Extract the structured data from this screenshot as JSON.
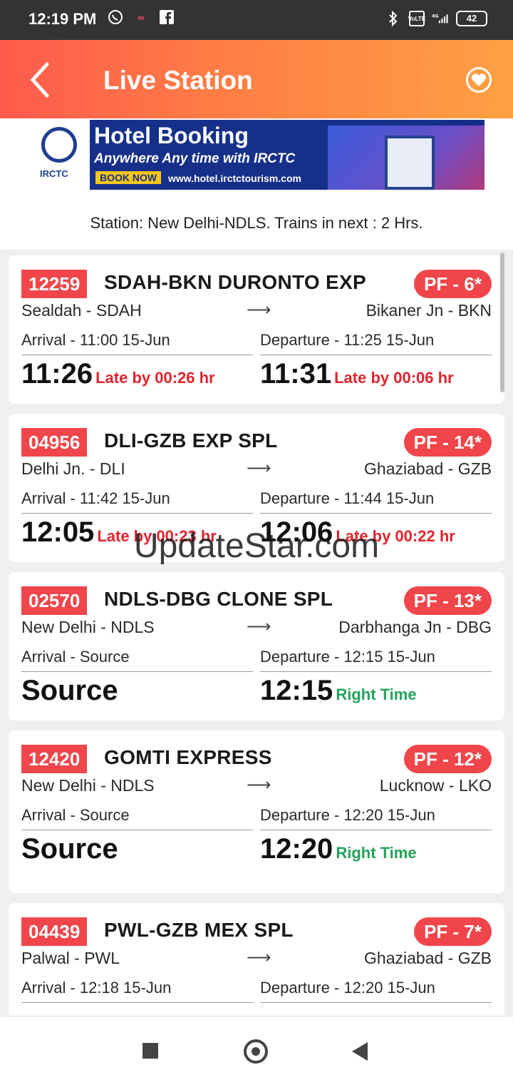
{
  "status_bar": {
    "time": "12:19 PM",
    "battery": "42",
    "network": "4G"
  },
  "app_bar": {
    "title": "Live Station"
  },
  "banner": {
    "logo_text": "IRCTC",
    "title": "Hotel Booking",
    "subtitle": "Anywhere Any time with IRCTC",
    "button": "BOOK NOW",
    "url": "www.hotel.irctctourism.com"
  },
  "station_info": "Station: New Delhi-NDLS. Trains in next : 2 Hrs.",
  "trains": [
    {
      "number": "12259",
      "name": "SDAH-BKN DURONTO EXP",
      "pf": "PF - 6*",
      "from": "Sealdah - SDAH",
      "to": "Bikaner Jn - BKN",
      "arrival_label": "Arrival -  11:00 15-Jun",
      "departure_label": "Departure -  11:25 15-Jun",
      "arrival_actual": "11:26",
      "arrival_status": "Late by 00:26 hr",
      "arrival_status_type": "late",
      "departure_actual": "11:31",
      "departure_status": "Late by 00:06 hr",
      "departure_status_type": "late"
    },
    {
      "number": "04956",
      "name": "DLI-GZB EXP SPL",
      "pf": "PF - 14*",
      "from": "Delhi Jn. - DLI",
      "to": "Ghaziabad - GZB",
      "arrival_label": "Arrival -  11:42 15-Jun",
      "departure_label": "Departure -  11:44 15-Jun",
      "arrival_actual": "12:05",
      "arrival_status": "Late by 00:23 hr",
      "arrival_status_type": "late",
      "departure_actual": "12:06",
      "departure_status": "Late by 00:22 hr",
      "departure_status_type": "late"
    },
    {
      "number": "02570",
      "name": "NDLS-DBG CLONE SPL",
      "pf": "PF - 13*",
      "from": "New Delhi - NDLS",
      "to": "Darbhanga Jn - DBG",
      "arrival_label": "Arrival -  Source",
      "departure_label": "Departure -  12:15 15-Jun",
      "arrival_actual": "Source",
      "arrival_status": "",
      "arrival_status_type": "none",
      "departure_actual": "12:15",
      "departure_status": "Right Time",
      "departure_status_type": "ontime"
    },
    {
      "number": "12420",
      "name": "GOMTI EXPRESS",
      "pf": "PF - 12*",
      "from": "New Delhi - NDLS",
      "to": "Lucknow - LKO",
      "arrival_label": "Arrival -  Source",
      "departure_label": "Departure -  12:20 15-Jun",
      "arrival_actual": "Source",
      "arrival_status": "",
      "arrival_status_type": "none",
      "departure_actual": "12:20",
      "departure_status": "Right Time",
      "departure_status_type": "ontime"
    },
    {
      "number": "04439",
      "name": "PWL-GZB MEX SPL",
      "pf": "PF - 7*",
      "from": "Palwal - PWL",
      "to": "Ghaziabad - GZB",
      "arrival_label": "Arrival -  12:18 15-Jun",
      "departure_label": "Departure -  12:20 15-Jun",
      "arrival_actual": "",
      "arrival_status": "",
      "arrival_status_type": "none",
      "departure_actual": "",
      "departure_status": "",
      "departure_status_type": "none"
    }
  ],
  "watermark": "UpdateStar.com",
  "colors": {
    "accent_start": "#ff5a4d",
    "accent_end": "#ffa043",
    "badge": "#f0454a",
    "late": "#e0242d",
    "ontime": "#22a35a"
  }
}
